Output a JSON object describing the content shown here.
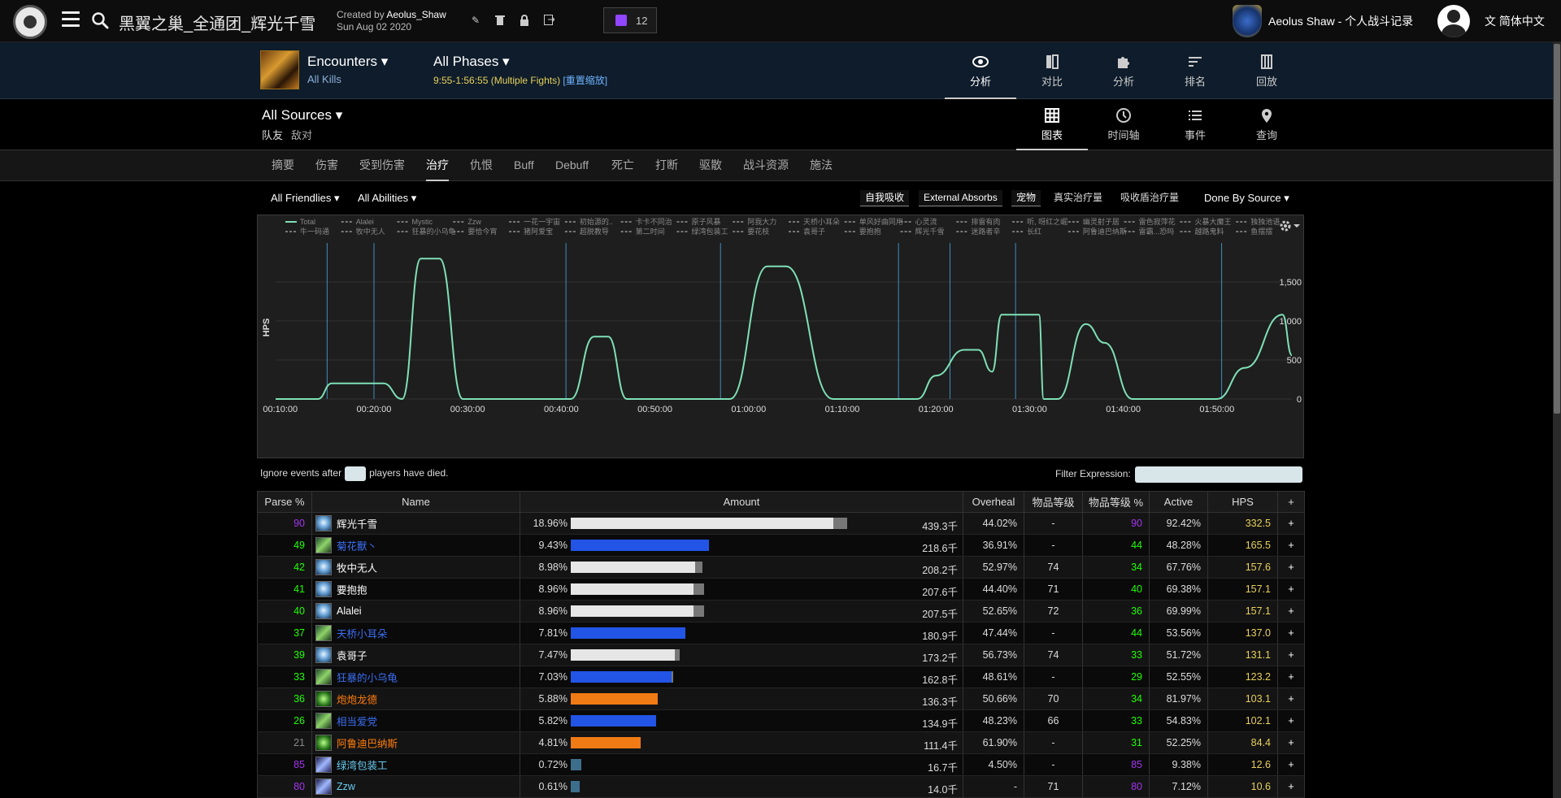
{
  "header": {
    "report_title": "黑翼之巢_全通团_辉光千雪",
    "created_by_prefix": "Created by ",
    "created_by_user": "Aeolus_Shaw",
    "created_date": "Sun Aug 02 2020",
    "twitch_count": "12",
    "user_name": "Aeolus Shaw - 个人战斗记录",
    "language": "简体中文"
  },
  "encounter": {
    "name": "Encounters ▾",
    "sub": "All Kills",
    "phase": "All Phases ▾",
    "time_range": "9:55-1:56:55 (Multiple Fights) ",
    "reset_zoom": "[重置缩放]",
    "main_tabs": [
      {
        "label": "分析",
        "icon": "eye-icon"
      },
      {
        "label": "对比",
        "icon": "compare-icon"
      },
      {
        "label": "分析",
        "icon": "puzzle-icon"
      },
      {
        "label": "排名",
        "icon": "ranking-icon"
      },
      {
        "label": "回放",
        "icon": "replay-icon"
      }
    ]
  },
  "sources": {
    "name": "All Sources ▾",
    "friendly": "队友",
    "enemy": "敌对",
    "view_tabs": [
      {
        "label": "图表",
        "icon": "grid-icon"
      },
      {
        "label": "时间轴",
        "icon": "clock-icon"
      },
      {
        "label": "事件",
        "icon": "list-icon"
      },
      {
        "label": "查询",
        "icon": "pin-icon"
      }
    ]
  },
  "tabs": [
    "摘要",
    "伤害",
    "受到伤害",
    "治疗",
    "仇恨",
    "Buff",
    "Debuff",
    "死亡",
    "打断",
    "驱散",
    "战斗资源",
    "施法"
  ],
  "active_tab_index": 3,
  "filters": {
    "friendlies": "All Friendlies ▾",
    "abilities": "All Abilities ▾",
    "self_absorb": "自我吸收",
    "external_absorbs": "External Absorbs",
    "pets": "宠物",
    "real_healing": "真实治疗量",
    "absorb_shield": "吸收盾治疗量",
    "done_by": "Done By Source ▾"
  },
  "chart_data": {
    "type": "line",
    "ylabel": "HPS",
    "xlabel": "",
    "title": "",
    "x_ticks": [
      "00:10:00",
      "00:20:00",
      "00:30:00",
      "00:40:00",
      "00:50:00",
      "01:00:00",
      "01:10:00",
      "01:20:00",
      "01:30:00",
      "01:40:00",
      "01:50:00"
    ],
    "y_ticks": [
      "0",
      "500",
      "1,000",
      "1,500"
    ],
    "ylim": [
      0,
      2000
    ],
    "xlim_minutes": [
      9.5,
      118
    ],
    "legend_row1": [
      "Total",
      "Alalei",
      "Mystic",
      "Zzw",
      "一花一宇宙",
      "初始源的..",
      "卡卡不同治",
      "原子风暴",
      "阿我大力",
      "天桥小耳朵",
      "单风好曲同用",
      "心灵流",
      "排雷有肉",
      "听, 呀红之崛",
      "幽灵射子居",
      "雷色寂萍花",
      "火暴大魔王",
      "独独池语"
    ],
    "legend_row2": [
      "牛一码通",
      "牧中无人",
      "狂暴的小乌龟",
      "要恰今宵",
      "猪阿爱宝",
      "超脱教导",
      "第二时间",
      "绿湾包装工",
      "要花枝",
      "袁哥子",
      "要抱抱",
      "辉光千雪",
      "迷路者辛",
      "长红",
      "阿鲁迪巴纳斯",
      "雷霸...恐吗",
      "越路鬼料",
      "鱼摆摆"
    ],
    "x_minutes": [
      9.5,
      14,
      15.5,
      21,
      23,
      25,
      27,
      29.5,
      34,
      36.5,
      40,
      41,
      43.5,
      45,
      47,
      52,
      58,
      62,
      64,
      69,
      75,
      78,
      80,
      83,
      84.5,
      86,
      87,
      91,
      91.5,
      93,
      96,
      98,
      101,
      110,
      113,
      117,
      118
    ],
    "series": [
      {
        "name": "Total",
        "color": "#7fe0b6",
        "values": [
          0,
          0,
          200,
          200,
          0,
          1800,
          1800,
          0,
          0,
          0,
          0,
          0,
          800,
          800,
          0,
          0,
          0,
          1700,
          1700,
          0,
          0,
          0,
          300,
          630,
          630,
          350,
          1080,
          1080,
          0,
          0,
          960,
          720,
          0,
          0,
          400,
          1080,
          560
        ]
      }
    ],
    "markers_minutes": [
      15,
      20,
      40.5,
      57,
      76,
      81.5,
      88.5,
      110.5
    ]
  },
  "ignore_prefix": "Ignore events after",
  "ignore_suffix": "players have died.",
  "filter_expression_label": "Filter Expression:",
  "table": {
    "headers": [
      "Parse %",
      "Name",
      "Amount",
      "Overheal",
      "物品等级",
      "物品等级 %",
      "Active",
      "HPS",
      "+"
    ],
    "rows": [
      {
        "parse": "90",
        "parse_color": "#a335ee",
        "name": "辉光千雪",
        "name_color": "#ffffff",
        "spec": "priest",
        "pct": "18.96%",
        "bar": 0.77,
        "over": 0.04,
        "bar_color": "#e6e6e6",
        "amount": "439.3千",
        "overheal": "44.02%",
        "ilvl": "-",
        "ilvl_pct": "90",
        "ilvl_color": "#a335ee",
        "active": "92.42%",
        "hps": "332.5"
      },
      {
        "parse": "49",
        "parse_color": "#1eff00",
        "name": "菊花獸丶",
        "name_color": "#3b6ef2",
        "spec": "shaman",
        "pct": "9.43%",
        "bar": 0.405,
        "over": 0.0,
        "bar_color": "#2255e6",
        "amount": "218.6千",
        "overheal": "36.91%",
        "ilvl": "-",
        "ilvl_pct": "44",
        "ilvl_color": "#1eff00",
        "active": "48.28%",
        "hps": "165.5"
      },
      {
        "parse": "42",
        "parse_color": "#1eff00",
        "name": "牧中无人",
        "name_color": "#ffffff",
        "spec": "priest",
        "pct": "8.98%",
        "bar": 0.365,
        "over": 0.02,
        "bar_color": "#e6e6e6",
        "amount": "208.2千",
        "overheal": "52.97%",
        "ilvl": "74",
        "ilvl_pct": "34",
        "ilvl_color": "#1eff00",
        "active": "67.76%",
        "hps": "157.6"
      },
      {
        "parse": "41",
        "parse_color": "#1eff00",
        "name": "要抱抱",
        "name_color": "#ffffff",
        "spec": "priest",
        "pct": "8.96%",
        "bar": 0.36,
        "over": 0.03,
        "bar_color": "#e6e6e6",
        "amount": "207.6千",
        "overheal": "44.40%",
        "ilvl": "71",
        "ilvl_pct": "40",
        "ilvl_color": "#1eff00",
        "active": "69.38%",
        "hps": "157.1"
      },
      {
        "parse": "40",
        "parse_color": "#1eff00",
        "name": "Alalei",
        "name_color": "#ffffff",
        "spec": "priest",
        "pct": "8.96%",
        "bar": 0.36,
        "over": 0.03,
        "bar_color": "#e6e6e6",
        "amount": "207.5千",
        "overheal": "52.65%",
        "ilvl": "72",
        "ilvl_pct": "36",
        "ilvl_color": "#1eff00",
        "active": "69.99%",
        "hps": "157.1"
      },
      {
        "parse": "37",
        "parse_color": "#1eff00",
        "name": "天桥小耳朵",
        "name_color": "#3b6ef2",
        "spec": "shaman",
        "pct": "7.81%",
        "bar": 0.335,
        "over": 0.0,
        "bar_color": "#2255e6",
        "amount": "180.9千",
        "overheal": "47.44%",
        "ilvl": "-",
        "ilvl_pct": "44",
        "ilvl_color": "#1eff00",
        "active": "53.56%",
        "hps": "137.0"
      },
      {
        "parse": "39",
        "parse_color": "#1eff00",
        "name": "袁哥子",
        "name_color": "#ffffff",
        "spec": "priest",
        "pct": "7.47%",
        "bar": 0.305,
        "over": 0.015,
        "bar_color": "#e6e6e6",
        "amount": "173.2千",
        "overheal": "56.73%",
        "ilvl": "74",
        "ilvl_pct": "33",
        "ilvl_color": "#1eff00",
        "active": "51.72%",
        "hps": "131.1"
      },
      {
        "parse": "33",
        "parse_color": "#1eff00",
        "name": "狂暴的小乌龟",
        "name_color": "#3b6ef2",
        "spec": "shaman",
        "pct": "7.03%",
        "bar": 0.295,
        "over": 0.005,
        "bar_color": "#2255e6",
        "amount": "162.8千",
        "overheal": "48.61%",
        "ilvl": "-",
        "ilvl_pct": "29",
        "ilvl_color": "#1eff00",
        "active": "52.55%",
        "hps": "123.2"
      },
      {
        "parse": "36",
        "parse_color": "#1eff00",
        "name": "炮炮龙德",
        "name_color": "#ff7d0a",
        "spec": "druid",
        "pct": "5.88%",
        "bar": 0.255,
        "over": 0.0,
        "bar_color": "#f07a14",
        "amount": "136.3千",
        "overheal": "50.66%",
        "ilvl": "70",
        "ilvl_pct": "34",
        "ilvl_color": "#1eff00",
        "active": "81.97%",
        "hps": "103.1"
      },
      {
        "parse": "26",
        "parse_color": "#1eff00",
        "name": "相当爱党",
        "name_color": "#3b6ef2",
        "spec": "shaman",
        "pct": "5.82%",
        "bar": 0.25,
        "over": 0.0,
        "bar_color": "#2255e6",
        "amount": "134.9千",
        "overheal": "48.23%",
        "ilvl": "66",
        "ilvl_pct": "33",
        "ilvl_color": "#1eff00",
        "active": "54.83%",
        "hps": "102.1"
      },
      {
        "parse": "21",
        "parse_color": "#888888",
        "name": "阿鲁迪巴纳斯",
        "name_color": "#ff7d0a",
        "spec": "druid",
        "pct": "4.81%",
        "bar": 0.205,
        "over": 0.0,
        "bar_color": "#f07a14",
        "amount": "111.4千",
        "overheal": "61.90%",
        "ilvl": "-",
        "ilvl_pct": "31",
        "ilvl_color": "#1eff00",
        "active": "52.25%",
        "hps": "84.4"
      },
      {
        "parse": "85",
        "parse_color": "#a335ee",
        "name": "绿湾包装工",
        "name_color": "#69ccf0",
        "spec": "mage",
        "pct": "0.72%",
        "bar": 0.03,
        "over": 0.0,
        "bar_color": "#3d6f8c",
        "amount": "16.7千",
        "overheal": "4.50%",
        "ilvl": "-",
        "ilvl_pct": "85",
        "ilvl_color": "#a335ee",
        "active": "9.38%",
        "hps": "12.6"
      },
      {
        "parse": "80",
        "parse_color": "#a335ee",
        "name": "Zzw",
        "name_color": "#69ccf0",
        "spec": "mage",
        "pct": "0.61%",
        "bar": 0.025,
        "over": 0.0,
        "bar_color": "#3d6f8c",
        "amount": "14.0千",
        "overheal": "-",
        "ilvl": "71",
        "ilvl_pct": "80",
        "ilvl_color": "#a335ee",
        "active": "7.12%",
        "hps": "10.6"
      }
    ]
  }
}
